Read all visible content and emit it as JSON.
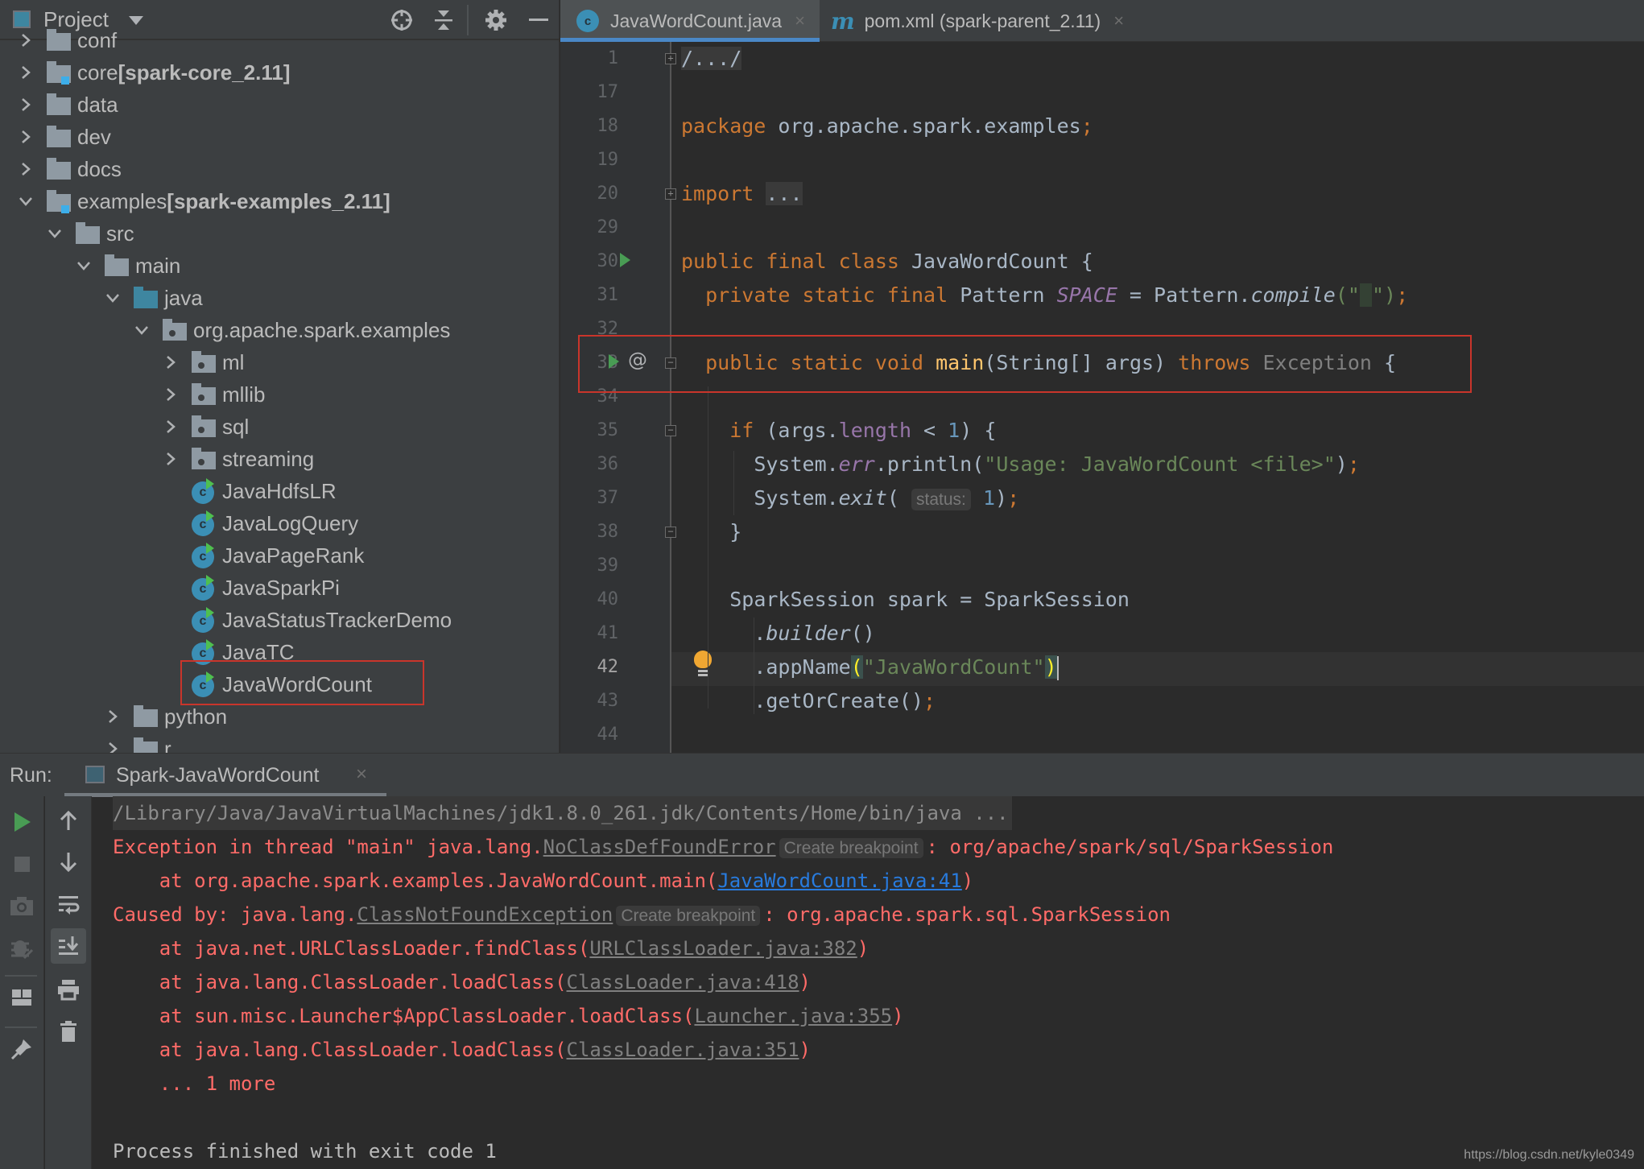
{
  "sidebar": {
    "title": "Project",
    "header_icons": [
      "locate-icon",
      "collapse-all-icon",
      "gear-icon",
      "minimize-icon"
    ],
    "tree": [
      {
        "label": "conf",
        "bold": "",
        "depth": 1,
        "chevron": "collapsed",
        "icon": "folder",
        "partial": true
      },
      {
        "label": "core ",
        "bold": "[spark-core_2.11]",
        "depth": 1,
        "chevron": "collapsed",
        "icon": "module"
      },
      {
        "label": "data",
        "bold": "",
        "depth": 1,
        "chevron": "collapsed",
        "icon": "folder"
      },
      {
        "label": "dev",
        "bold": "",
        "depth": 1,
        "chevron": "collapsed",
        "icon": "folder"
      },
      {
        "label": "docs",
        "bold": "",
        "depth": 1,
        "chevron": "collapsed",
        "icon": "folder"
      },
      {
        "label": "examples ",
        "bold": "[spark-examples_2.11]",
        "depth": 1,
        "chevron": "expanded",
        "icon": "module"
      },
      {
        "label": "src",
        "bold": "",
        "depth": 2,
        "chevron": "expanded",
        "icon": "folder"
      },
      {
        "label": "main",
        "bold": "",
        "depth": 3,
        "chevron": "expanded",
        "icon": "folder"
      },
      {
        "label": "java",
        "bold": "",
        "depth": 4,
        "chevron": "expanded",
        "icon": "source-folder"
      },
      {
        "label": "org.apache.spark.examples",
        "bold": "",
        "depth": 5,
        "chevron": "expanded",
        "icon": "package"
      },
      {
        "label": "ml",
        "bold": "",
        "depth": 6,
        "chevron": "collapsed",
        "icon": "package"
      },
      {
        "label": "mllib",
        "bold": "",
        "depth": 6,
        "chevron": "collapsed",
        "icon": "package"
      },
      {
        "label": "sql",
        "bold": "",
        "depth": 6,
        "chevron": "collapsed",
        "icon": "package"
      },
      {
        "label": "streaming",
        "bold": "",
        "depth": 6,
        "chevron": "collapsed",
        "icon": "package"
      },
      {
        "label": "JavaHdfsLR",
        "bold": "",
        "depth": 6,
        "chevron": "none",
        "icon": "class"
      },
      {
        "label": "JavaLogQuery",
        "bold": "",
        "depth": 6,
        "chevron": "none",
        "icon": "class"
      },
      {
        "label": "JavaPageRank",
        "bold": "",
        "depth": 6,
        "chevron": "none",
        "icon": "class"
      },
      {
        "label": "JavaSparkPi",
        "bold": "",
        "depth": 6,
        "chevron": "none",
        "icon": "class"
      },
      {
        "label": "JavaStatusTrackerDemo",
        "bold": "",
        "depth": 6,
        "chevron": "none",
        "icon": "class"
      },
      {
        "label": "JavaTC",
        "bold": "",
        "depth": 6,
        "chevron": "none",
        "icon": "class"
      },
      {
        "label": "JavaWordCount",
        "bold": "",
        "depth": 6,
        "chevron": "none",
        "icon": "class",
        "highlighted": true
      },
      {
        "label": "python",
        "bold": "",
        "depth": 4,
        "chevron": "collapsed",
        "icon": "folder"
      },
      {
        "label": "r",
        "bold": "",
        "depth": 4,
        "chevron": "collapsed",
        "icon": "folder",
        "partial": true
      }
    ]
  },
  "editor": {
    "tabs": [
      {
        "label": "JavaWordCount.java",
        "icon": "java-class-icon",
        "active": true
      },
      {
        "label": "pom.xml (spark-parent_2.11)",
        "icon": "maven-icon",
        "active": false
      }
    ],
    "close_glyph": "×",
    "current_line": 42,
    "line_numbers": [
      "1",
      "17",
      "18",
      "19",
      "20",
      "29",
      "30",
      "31",
      "32",
      "33",
      "34",
      "35",
      "36",
      "37",
      "38",
      "39",
      "40",
      "41",
      "42",
      "43",
      "44"
    ],
    "lines": {
      "l1": {
        "fold": "/.../"
      },
      "l18": {
        "kw": "package",
        "rest": " org.apache.spark.examples",
        "semi": ";"
      },
      "l20": {
        "kw": "import",
        "fold": "..."
      },
      "l30": {
        "kw": "public final class",
        "rest": " JavaWordCount {"
      },
      "l31": {
        "kw": "private static final",
        "type": " Pattern ",
        "field": "SPACE",
        "mid": " = Pattern.",
        "method": "compile",
        "open": "(\"",
        "ws": " ",
        "close": "\")",
        "semi": ";"
      },
      "l33": {
        "kw": "public static void",
        "fn": "main",
        "params": "(String[] args) ",
        "throws": "throws",
        "exc": " Exception",
        "brace": " {"
      },
      "l35": {
        "kw": "if",
        "p1": " (args.",
        "field": "length",
        "p2": " < ",
        "num": "1",
        "p3": ") {"
      },
      "l36": {
        "pre": "System.",
        "field": "err",
        "mid": ".println(",
        "str": "\"Usage: JavaWordCount <file>\"",
        "close": ")",
        "semi": ";"
      },
      "l37": {
        "pre": "System.",
        "method": "exit",
        "open": "(",
        "hint": "status:",
        "num": "1",
        "close": ")",
        "semi": ";"
      },
      "l38": {
        "text": "}"
      },
      "l40": {
        "text": "SparkSession spark = SparkSession"
      },
      "l41": {
        "dot": ".",
        "method": "builder",
        "parens": "()"
      },
      "l42": {
        "pre": ".appName",
        "open": "(",
        "str": "\"JavaWordCount\"",
        "close": ")"
      },
      "l43": {
        "text": ".getOrCreate()",
        "semi": ";"
      }
    },
    "highlight_box": "main method declaration (line 33)"
  },
  "run": {
    "label": "Run:",
    "tab_label": "Spark-JavaWordCount",
    "close_glyph": "×",
    "left_tools": [
      "rerun-icon",
      "stop-icon",
      "snapshot-icon",
      "debug-icon",
      "layout-icon",
      "pin-icon"
    ],
    "right_tools": [
      "scroll-up-icon",
      "scroll-down-icon",
      "soft-wrap-icon",
      "scroll-to-end-icon",
      "print-icon",
      "clear-icon"
    ],
    "console": {
      "cmd": "/Library/Java/JavaVirtualMachines/jdk1.8.0_261.jdk/Contents/Home/bin/java ...",
      "l1_pre": "Exception in thread \"main\" java.lang.",
      "l1_link": "NoClassDefFoundError",
      "bp": "Create breakpoint",
      "l1_post": ": org/apache/spark/sql/SparkSession",
      "l2_pre": "    at org.apache.spark.examples.JavaWordCount.main(",
      "l2_link": "JavaWordCount.java:41",
      "close": ")",
      "l3_pre": "Caused by: java.lang.",
      "l3_link": "ClassNotFoundException",
      "l3_post": ": org.apache.spark.sql.SparkSession",
      "stack": [
        {
          "pre": "    at java.net.URLClassLoader.findClass(",
          "link": "URLClassLoader.java:382"
        },
        {
          "pre": "    at java.lang.ClassLoader.loadClass(",
          "link": "ClassLoader.java:418"
        },
        {
          "pre": "    at sun.misc.Launcher$AppClassLoader.loadClass(",
          "link": "Launcher.java:355"
        },
        {
          "pre": "    at java.lang.ClassLoader.loadClass(",
          "link": "ClassLoader.java:351"
        }
      ],
      "more": "    ... 1 more",
      "exit": "Process finished with exit code 1"
    }
  },
  "watermark": "https://blog.csdn.net/kyle0349",
  "colors": {
    "keyword": "#cc7832",
    "string": "#6a8759",
    "number": "#6897bb",
    "field": "#9876aa",
    "method_decl": "#ffc66d",
    "error": "#ff6b68",
    "link": "#287bde",
    "highlight_box": "#c9352b"
  }
}
